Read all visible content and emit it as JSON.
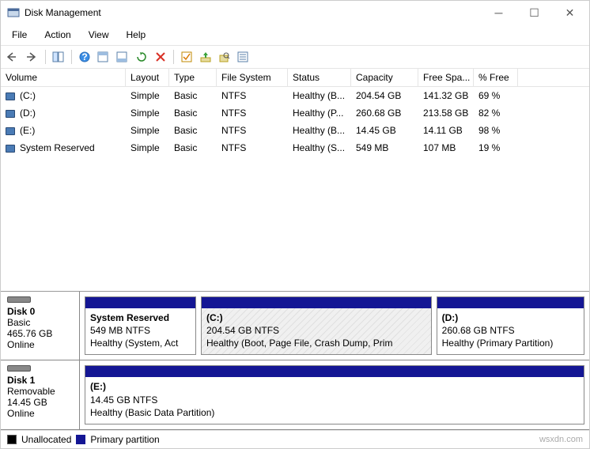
{
  "window": {
    "title": "Disk Management"
  },
  "menu": {
    "file": "File",
    "action": "Action",
    "view": "View",
    "help": "Help"
  },
  "columns": {
    "volume": "Volume",
    "layout": "Layout",
    "type": "Type",
    "fs": "File System",
    "status": "Status",
    "capacity": "Capacity",
    "free": "Free Spa...",
    "pct": "% Free"
  },
  "volumes": [
    {
      "name": "(C:)",
      "layout": "Simple",
      "type": "Basic",
      "fs": "NTFS",
      "status": "Healthy (B...",
      "capacity": "204.54 GB",
      "free": "141.32 GB",
      "pct": "69 %"
    },
    {
      "name": "(D:)",
      "layout": "Simple",
      "type": "Basic",
      "fs": "NTFS",
      "status": "Healthy (P...",
      "capacity": "260.68 GB",
      "free": "213.58 GB",
      "pct": "82 %"
    },
    {
      "name": "(E:)",
      "layout": "Simple",
      "type": "Basic",
      "fs": "NTFS",
      "status": "Healthy (B...",
      "capacity": "14.45 GB",
      "free": "14.11 GB",
      "pct": "98 %"
    },
    {
      "name": "System Reserved",
      "layout": "Simple",
      "type": "Basic",
      "fs": "NTFS",
      "status": "Healthy (S...",
      "capacity": "549 MB",
      "free": "107 MB",
      "pct": "19 %"
    }
  ],
  "disks": [
    {
      "name": "Disk 0",
      "kind": "Basic",
      "size": "465.76 GB",
      "state": "Online",
      "parts": [
        {
          "name": "System Reserved",
          "line2": "549 MB NTFS",
          "line3": "Healthy (System, Act",
          "flex": 1.2,
          "hatched": false
        },
        {
          "name": "(C:)",
          "line2": "204.54 GB NTFS",
          "line3": "Healthy (Boot, Page File, Crash Dump, Prim",
          "flex": 2.5,
          "hatched": true
        },
        {
          "name": "(D:)",
          "line2": "260.68 GB NTFS",
          "line3": "Healthy (Primary Partition)",
          "flex": 1.6,
          "hatched": false
        }
      ]
    },
    {
      "name": "Disk 1",
      "kind": "Removable",
      "size": "14.45 GB",
      "state": "Online",
      "parts": [
        {
          "name": "(E:)",
          "line2": "14.45 GB NTFS",
          "line3": "Healthy (Basic Data Partition)",
          "flex": 1,
          "hatched": false
        }
      ]
    }
  ],
  "legend": {
    "unalloc": "Unallocated",
    "primary": "Primary partition"
  },
  "watermark": "wsxdn.com"
}
